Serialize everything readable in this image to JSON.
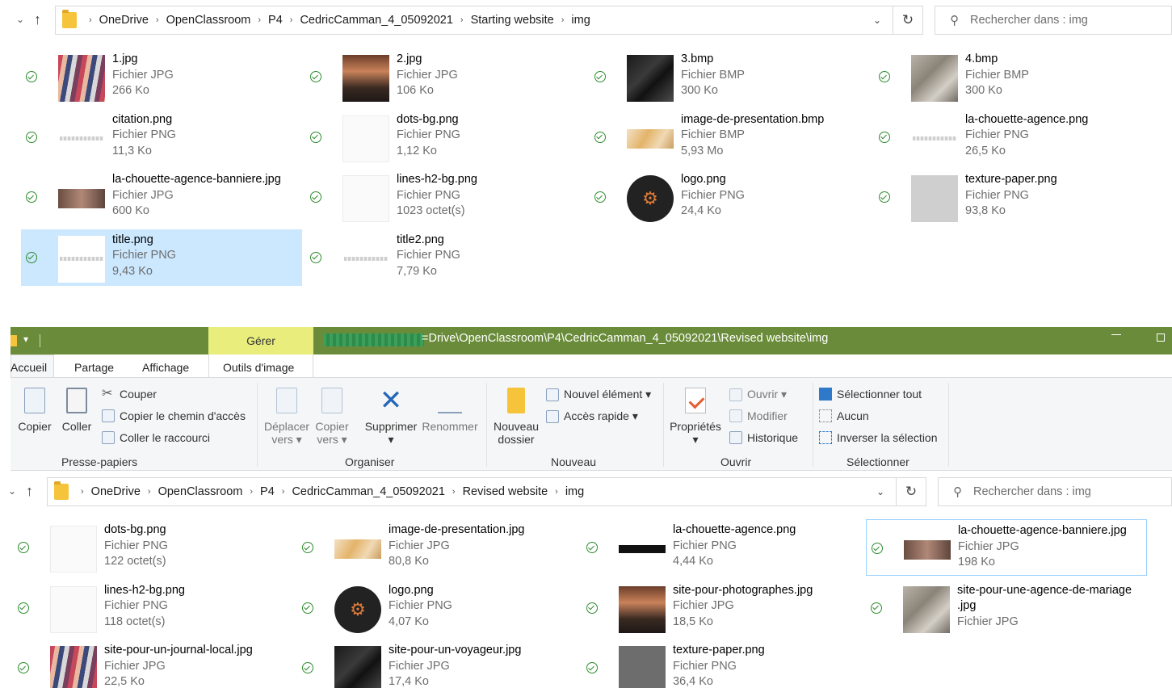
{
  "top_window": {
    "breadcrumb": [
      "OneDrive",
      "OpenClassroom",
      "P4",
      "CedricCamman_4_05092021",
      "Starting website",
      "img"
    ],
    "search_placeholder": "Rechercher dans : img",
    "files": [
      {
        "name": "1.jpg",
        "type": "Fichier JPG",
        "size": "266 Ko",
        "thumb": "clothes"
      },
      {
        "name": "2.jpg",
        "type": "Fichier JPG",
        "size": "106 Ko",
        "thumb": "photo"
      },
      {
        "name": "3.bmp",
        "type": "Fichier BMP",
        "size": "300 Ko",
        "thumb": "desk"
      },
      {
        "name": "4.bmp",
        "type": "Fichier BMP",
        "size": "300 Ko",
        "thumb": "laptop"
      },
      {
        "name": "citation.png",
        "type": "Fichier PNG",
        "size": "11,3 Ko",
        "thumb": "line"
      },
      {
        "name": "dots-bg.png",
        "type": "Fichier PNG",
        "size": "1,12 Ko",
        "thumb": "white"
      },
      {
        "name": "image-de-presentation.bmp",
        "type": "Fichier BMP",
        "size": "5,93 Mo",
        "thumb": "hands"
      },
      {
        "name": "la-chouette-agence.png",
        "type": "Fichier PNG",
        "size": "26,5 Ko",
        "thumb": "line"
      },
      {
        "name": "la-chouette-agence-banniere.jpg",
        "type": "Fichier JPG",
        "size": "600 Ko",
        "thumb": "banner"
      },
      {
        "name": "lines-h2-bg.png",
        "type": "Fichier PNG",
        "size": "1023 octet(s)",
        "thumb": "white"
      },
      {
        "name": "logo.png",
        "type": "Fichier PNG",
        "size": "24,4 Ko",
        "thumb": "owl"
      },
      {
        "name": "texture-paper.png",
        "type": "Fichier PNG",
        "size": "93,8 Ko",
        "thumb": "paper"
      },
      {
        "name": "title.png",
        "type": "Fichier PNG",
        "size": "9,43 Ko",
        "thumb": "line",
        "selected": true
      },
      {
        "name": "title2.png",
        "type": "Fichier PNG",
        "size": "7,79 Ko",
        "thumb": "line"
      }
    ]
  },
  "bottom_window": {
    "title_path": "=Drive\\OpenClassroom\\P4\\CedricCamman_4_05092021\\Revised website\\img",
    "context_tab": "Gérer",
    "tabs": [
      "Accueil",
      "Partage",
      "Affichage",
      "Outils d'image"
    ],
    "ribbon": {
      "presse_papiers": {
        "label": "Presse-papiers",
        "copier": "Copier",
        "coller": "Coller",
        "couper": "Couper",
        "copier_chemin": "Copier le chemin d'accès",
        "coller_raccourci": "Coller le raccourci"
      },
      "organiser": {
        "label": "Organiser",
        "deplacer": "Déplacer",
        "deplacer2": "vers ▾",
        "copier_vers": "Copier",
        "copier_vers2": "vers ▾",
        "supprimer": "Supprimer",
        "renommer": "Renommer"
      },
      "nouveau": {
        "label": "Nouveau",
        "nouveau_dossier": "Nouveau",
        "nouveau_dossier2": "dossier",
        "nouvel_element": "Nouvel élément ▾",
        "acces_rapide": "Accès rapide ▾"
      },
      "ouvrir": {
        "label": "Ouvrir",
        "proprietes": "Propriétés",
        "ouvrir": "Ouvrir ▾",
        "modifier": "Modifier",
        "historique": "Historique"
      },
      "selectionner": {
        "label": "Sélectionner",
        "tout": "Sélectionner tout",
        "aucun": "Aucun",
        "inverser": "Inverser la sélection"
      }
    },
    "breadcrumb": [
      "OneDrive",
      "OpenClassroom",
      "P4",
      "CedricCamman_4_05092021",
      "Revised website",
      "img"
    ],
    "search_placeholder": "Rechercher dans : img",
    "files": [
      {
        "name": "dots-bg.png",
        "type": "Fichier PNG",
        "size": "122 octet(s)",
        "thumb": "white"
      },
      {
        "name": "image-de-presentation.jpg",
        "type": "Fichier JPG",
        "size": "80,8 Ko",
        "thumb": "hands"
      },
      {
        "name": "la-chouette-agence.png",
        "type": "Fichier PNG",
        "size": "4,44 Ko",
        "thumb": "blackbar"
      },
      {
        "name": "la-chouette-agence-banniere.jpg",
        "type": "Fichier JPG",
        "size": "198 Ko",
        "thumb": "banner",
        "hover": true
      },
      {
        "name": "lines-h2-bg.png",
        "type": "Fichier PNG",
        "size": "118 octet(s)",
        "thumb": "white"
      },
      {
        "name": "logo.png",
        "type": "Fichier PNG",
        "size": "4,07 Ko",
        "thumb": "owl"
      },
      {
        "name": "site-pour-photographes.jpg",
        "type": "Fichier JPG",
        "size": "18,5 Ko",
        "thumb": "photo"
      },
      {
        "name": "site-pour-une-agence-de-mariage",
        "name2": ".jpg",
        "type": "Fichier JPG",
        "size": "",
        "thumb": "laptop"
      },
      {
        "name": "site-pour-un-journal-local.jpg",
        "type": "Fichier JPG",
        "size": "22,5 Ko",
        "thumb": "clothes"
      },
      {
        "name": "site-pour-un-voyageur.jpg",
        "type": "Fichier JPG",
        "size": "17,4 Ko",
        "thumb": "desk"
      },
      {
        "name": "texture-paper.png",
        "type": "Fichier PNG",
        "size": "36,4 Ko",
        "thumb": "paper2"
      }
    ]
  },
  "colors": {
    "titlebar": "#6a8c3a",
    "context_tab": "#e8ed7c",
    "selection": "#cce8ff",
    "sync_check": "#2e8b2e"
  }
}
